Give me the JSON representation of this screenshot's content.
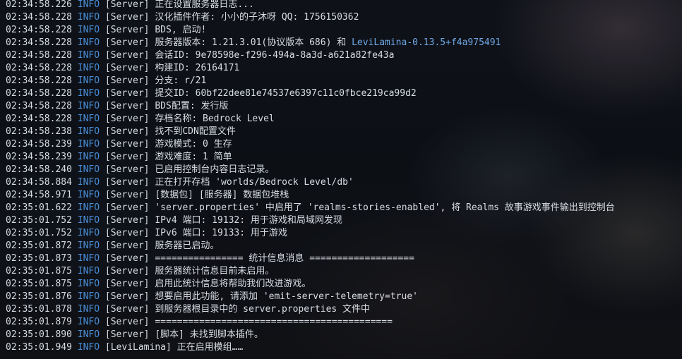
{
  "colors": {
    "level": "#4a8fd9",
    "text": "#d8dde3",
    "link": "#6fa8e6"
  },
  "lines": [
    {
      "time": "02:34:58.226",
      "level": "INFO",
      "tag": "[Server]",
      "msg": "正在设置服务器日志..."
    },
    {
      "time": "02:34:58.228",
      "level": "INFO",
      "tag": "[Server]",
      "msg": "汉化插件作者: 小小的子沐呀 QQ: 1756150362"
    },
    {
      "time": "02:34:58.228",
      "level": "INFO",
      "tag": "[Server]",
      "msg": "BDS, 启动!"
    },
    {
      "time": "02:34:58.228",
      "level": "INFO",
      "tag": "[Server]",
      "msg": "服务器版本: 1.21.3.01(协议版本 686) 和 ",
      "link": "LeviLamina-0.13.5+f4a975491"
    },
    {
      "time": "02:34:58.228",
      "level": "INFO",
      "tag": "[Server]",
      "msg": "会话ID: 9e78598e-f296-494a-8a3d-a621a82fe43a"
    },
    {
      "time": "02:34:58.228",
      "level": "INFO",
      "tag": "[Server]",
      "msg": "构建ID: 26164171"
    },
    {
      "time": "02:34:58.228",
      "level": "INFO",
      "tag": "[Server]",
      "msg": "分支: r/21"
    },
    {
      "time": "02:34:58.228",
      "level": "INFO",
      "tag": "[Server]",
      "msg": "提交ID: 60bf22dee81e74537e6397c11c0fbce219ca99d2"
    },
    {
      "time": "02:34:58.228",
      "level": "INFO",
      "tag": "[Server]",
      "msg": "BDS配置: 发行版"
    },
    {
      "time": "02:34:58.228",
      "level": "INFO",
      "tag": "[Server]",
      "msg": "存档名称: Bedrock Level"
    },
    {
      "time": "02:34:58.238",
      "level": "INFO",
      "tag": "[Server]",
      "msg": "找不到CDN配置文件"
    },
    {
      "time": "02:34:58.239",
      "level": "INFO",
      "tag": "[Server]",
      "msg": "游戏模式: 0 生存"
    },
    {
      "time": "02:34:58.239",
      "level": "INFO",
      "tag": "[Server]",
      "msg": "游戏难度: 1 简单"
    },
    {
      "time": "02:34:58.240",
      "level": "INFO",
      "tag": "[Server]",
      "msg": "已启用控制台内容日志记录。"
    },
    {
      "time": "02:34:58.884",
      "level": "INFO",
      "tag": "[Server]",
      "msg": "正在打开存档 'worlds/Bedrock Level/db'"
    },
    {
      "time": "02:34:58.971",
      "level": "INFO",
      "tag": "[Server]",
      "msg": "[数据包] [服务器] 数据包堆栈"
    },
    {
      "time": "02:35:01.622",
      "level": "INFO",
      "tag": "[Server]",
      "msg": "'server.properties' 中启用了 'realms-stories-enabled', 将 Realms 故事游戏事件输出到控制台"
    },
    {
      "time": "02:35:01.752",
      "level": "INFO",
      "tag": "[Server]",
      "msg": "IPv4 端口: 19132: 用于游戏和局域网发现"
    },
    {
      "time": "02:35:01.752",
      "level": "INFO",
      "tag": "[Server]",
      "msg": "IPv6 端口: 19133: 用于游戏"
    },
    {
      "time": "02:35:01.872",
      "level": "INFO",
      "tag": "[Server]",
      "msg": "服务器已启动。"
    },
    {
      "time": "02:35:01.873",
      "level": "INFO",
      "tag": "[Server]",
      "msg": "================ 统计信息消息 ==================="
    },
    {
      "time": "02:35:01.875",
      "level": "INFO",
      "tag": "[Server]",
      "msg": "服务器统计信息目前未启用。"
    },
    {
      "time": "02:35:01.875",
      "level": "INFO",
      "tag": "[Server]",
      "msg": "启用此统计信息将帮助我们改进游戏。"
    },
    {
      "time": "02:35:01.876",
      "level": "INFO",
      "tag": "[Server]",
      "msg": "想要启用此功能, 请添加 'emit-server-telemetry=true'"
    },
    {
      "time": "02:35:01.878",
      "level": "INFO",
      "tag": "[Server]",
      "msg": "到服务器根目录中的 server.properties 文件中"
    },
    {
      "time": "02:35:01.879",
      "level": "INFO",
      "tag": "[Server]",
      "msg": "==========================================="
    },
    {
      "time": "02:35:01.890",
      "level": "INFO",
      "tag": "[Server]",
      "msg": "[脚本] 未找到脚本插件。"
    },
    {
      "time": "02:35:01.949",
      "level": "INFO",
      "tag": "[LeviLamina]",
      "msg": "正在启用模组……"
    }
  ]
}
